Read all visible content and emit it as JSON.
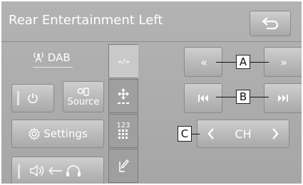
{
  "header": {
    "title": "Rear Entertainment Left"
  },
  "left_panel": {
    "source_name": "DAB",
    "source_button_label": "Source",
    "settings_button_label": "Settings"
  },
  "tabs": [
    {
      "label": "«/»"
    },
    {
      "label": ""
    },
    {
      "label": "123"
    },
    {
      "label": ""
    }
  ],
  "content": {
    "callout_a": "A",
    "callout_b": "B",
    "callout_c": "C",
    "channel_label": "CH"
  }
}
